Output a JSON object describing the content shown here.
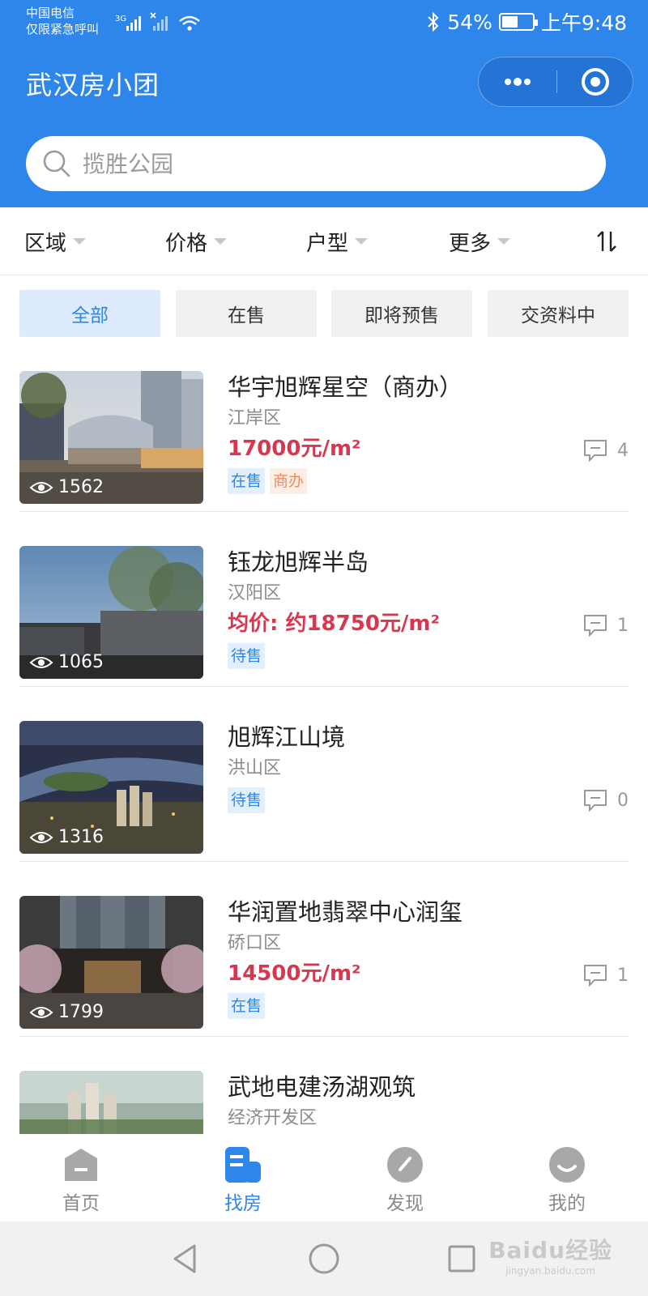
{
  "status_bar": {
    "carrier_line1": "中国电信",
    "carrier_line2": "仅限紧急呼叫",
    "network": "3G",
    "battery": "54%",
    "battery_level": 0.54,
    "time": "上午9:48"
  },
  "header": {
    "title": "武汉房小团",
    "more_icon": "ellipsis-icon",
    "close_icon": "target-icon"
  },
  "search": {
    "placeholder": "揽胜公园"
  },
  "filters": {
    "region": "区域",
    "price": "价格",
    "layout": "户型",
    "more": "更多"
  },
  "status_tabs": [
    {
      "label": "全部",
      "active": true
    },
    {
      "label": "在售",
      "active": false
    },
    {
      "label": "即将预售",
      "active": false
    },
    {
      "label": "交资料中",
      "active": false
    }
  ],
  "listings": [
    {
      "name": "华宇旭辉星空（商办）",
      "district": "江岸区",
      "price": "17000元/m²",
      "views": "1562",
      "comments": "4",
      "badges": [
        "在售",
        "商办"
      ]
    },
    {
      "name": "钰龙旭辉半岛",
      "district": "汉阳区",
      "price": "均价: 约18750元/m²",
      "views": "1065",
      "comments": "1",
      "badges": [
        "待售"
      ]
    },
    {
      "name": "旭辉江山境",
      "district": "洪山区",
      "price": "",
      "views": "1316",
      "comments": "0",
      "badges": [
        "待售"
      ]
    },
    {
      "name": "华润置地翡翠中心润玺",
      "district": "硚口区",
      "price": "14500元/m²",
      "views": "1799",
      "comments": "1",
      "badges": [
        "在售"
      ]
    },
    {
      "name": "武地电建汤湖观筑",
      "district": "经济开发区",
      "price": "",
      "views": "",
      "comments": "",
      "badges": []
    }
  ],
  "tabbar": [
    {
      "label": "首页",
      "icon": "home-icon",
      "active": false
    },
    {
      "label": "找房",
      "icon": "house-search-icon",
      "active": true
    },
    {
      "label": "发现",
      "icon": "compass-icon",
      "active": false
    },
    {
      "label": "我的",
      "icon": "smile-icon",
      "active": false
    }
  ],
  "watermark": {
    "main": "Baidu经验",
    "sub": "jingyan.baidu.com"
  },
  "colors": {
    "primary": "#2f86ea",
    "price": "#d8384f",
    "badge_biz": "#ee8a5a"
  }
}
